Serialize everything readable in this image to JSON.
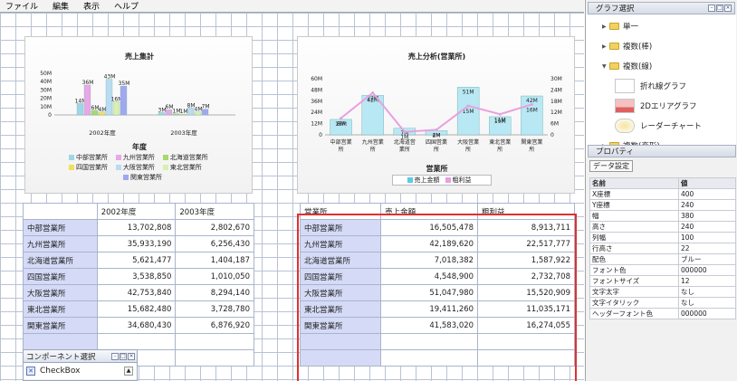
{
  "menu": [
    "ファイル",
    "編集",
    "表示",
    "ヘルプ"
  ],
  "chart1": {
    "title": "売上集計",
    "yticks": [
      "50M",
      "40M",
      "30M",
      "20M",
      "10M",
      "0"
    ],
    "xcats": [
      "2002年度",
      "2003年度"
    ],
    "xlabel": "年度",
    "legend": [
      "中部営業所",
      "九州営業所",
      "北海道営業所",
      "四国営業所",
      "大阪営業所",
      "東北営業所",
      "関東営業所"
    ],
    "data_labels": [
      "14M",
      "36M",
      "6M",
      "4M",
      "43M",
      "16M",
      "35M",
      "3M",
      "6M",
      "1M",
      "1M",
      "8M",
      "4M",
      "7M"
    ]
  },
  "chart2": {
    "title": "売上分析(営業所)",
    "yticks_left": [
      "60M",
      "48M",
      "36M",
      "24M",
      "12M",
      "0"
    ],
    "yticks_right": [
      "30M",
      "24M",
      "18M",
      "12M",
      "6M",
      "0"
    ],
    "xcats": [
      "中部営業所",
      "九州営業所",
      "北海道営業所",
      "四国営業所",
      "大阪営業所",
      "東北営業所",
      "関東営業所"
    ],
    "xlabel": "営業所",
    "legend": [
      "売上金額",
      "粗利益"
    ],
    "bar_labels": [
      "16M",
      "42M",
      "7M",
      "4M",
      "51M",
      "19M",
      "42M"
    ],
    "line_labels": [
      "8M",
      "22M",
      "1M",
      "2M",
      "15M",
      "11M",
      "16M"
    ]
  },
  "chart_data": [
    {
      "type": "bar",
      "title": "売上集計",
      "xlabel": "年度",
      "categories": [
        "2002年度",
        "2003年度"
      ],
      "ylim": [
        0,
        50
      ],
      "series": [
        {
          "name": "中部営業所",
          "values": [
            13.7,
            2.8
          ],
          "color": "#9fd6e6"
        },
        {
          "name": "九州営業所",
          "values": [
            35.9,
            6.3
          ],
          "color": "#e6a8e6"
        },
        {
          "name": "北海道営業所",
          "values": [
            5.6,
            1.4
          ],
          "color": "#a8d86e"
        },
        {
          "name": "四国営業所",
          "values": [
            3.5,
            1.0
          ],
          "color": "#f0e05c"
        },
        {
          "name": "大阪営業所",
          "values": [
            42.8,
            8.3
          ],
          "color": "#b9dcf0"
        },
        {
          "name": "東北営業所",
          "values": [
            15.7,
            3.7
          ],
          "color": "#d8f0b0"
        },
        {
          "name": "関東営業所",
          "values": [
            34.7,
            6.9
          ],
          "color": "#a0a8f0"
        }
      ]
    },
    {
      "type": "bar",
      "title": "売上分析(営業所)",
      "xlabel": "営業所",
      "categories": [
        "中部営業所",
        "九州営業所",
        "北海道営業所",
        "四国営業所",
        "大阪営業所",
        "東北営業所",
        "関東営業所"
      ],
      "ylim": [
        0,
        60
      ],
      "y2lim": [
        0,
        30
      ],
      "series": [
        {
          "name": "売上金額",
          "type": "bar",
          "values": [
            16.5,
            42.2,
            7.0,
            4.5,
            51.0,
            19.4,
            41.6
          ],
          "color": "#b8e8f4"
        },
        {
          "name": "粗利益",
          "type": "line",
          "axis": "right",
          "values": [
            8.9,
            22.5,
            1.6,
            2.7,
            15.5,
            11.0,
            16.3
          ],
          "color": "#e8a0e0"
        }
      ]
    }
  ],
  "table1": {
    "headers": [
      "",
      "2002年度",
      "2003年度"
    ],
    "rows": [
      [
        "中部営業所",
        "13,702,808",
        "2,802,670"
      ],
      [
        "九州営業所",
        "35,933,190",
        "6,256,430"
      ],
      [
        "北海道営業所",
        "5,621,477",
        "1,404,187"
      ],
      [
        "四国営業所",
        "3,538,850",
        "1,010,050"
      ],
      [
        "大阪営業所",
        "42,753,840",
        "8,294,140"
      ],
      [
        "東北営業所",
        "15,682,480",
        "3,728,780"
      ],
      [
        "関東営業所",
        "34,680,430",
        "6,876,920"
      ]
    ]
  },
  "table2": {
    "headers": [
      "営業所",
      "売上金額",
      "粗利益"
    ],
    "rows": [
      [
        "中部営業所",
        "16,505,478",
        "8,913,711"
      ],
      [
        "九州営業所",
        "42,189,620",
        "22,517,777"
      ],
      [
        "北海道営業所",
        "7,018,382",
        "1,587,922"
      ],
      [
        "四国営業所",
        "4,548,900",
        "2,732,708"
      ],
      [
        "大阪営業所",
        "51,047,980",
        "15,520,909"
      ],
      [
        "東北営業所",
        "19,411,260",
        "11,035,171"
      ],
      [
        "関東営業所",
        "41,583,020",
        "16,274,055"
      ]
    ]
  },
  "component_panel": {
    "title": "コンポーネント選択",
    "item": "CheckBox"
  },
  "graph_panel": {
    "title": "グラフ選択",
    "nodes": [
      "単一",
      "複数(棒)",
      "複数(線)",
      "複数(変形)"
    ],
    "leaves": [
      "折れ線グラフ",
      "2Dエリアグラフ",
      "レーダーチャート"
    ]
  },
  "property_panel": {
    "title": "プロパティ",
    "button": "データ設定",
    "headers": [
      "名前",
      "値"
    ],
    "rows": [
      [
        "X座標",
        "400"
      ],
      [
        "Y座標",
        "240"
      ],
      [
        "幅",
        "380"
      ],
      [
        "高さ",
        "240"
      ],
      [
        "列幅",
        "100"
      ],
      [
        "行高さ",
        "22"
      ],
      [
        "配色",
        "ブルー"
      ],
      [
        "フォント色",
        "000000"
      ],
      [
        "フォントサイズ",
        "12"
      ],
      [
        "文字太字",
        "なし"
      ],
      [
        "文字イタリック",
        "なし"
      ],
      [
        "ヘッダーフォント色",
        "000000"
      ]
    ]
  }
}
